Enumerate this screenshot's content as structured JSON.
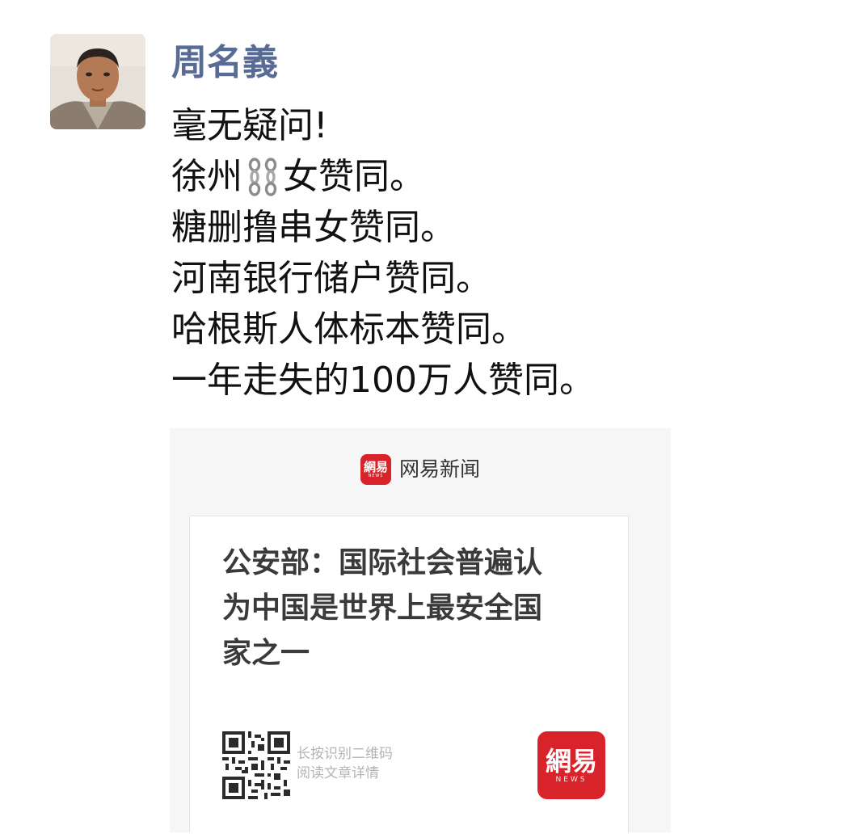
{
  "post": {
    "author": "周名義",
    "lines": [
      {
        "text": "毫无疑问!"
      },
      {
        "before": "徐州",
        "icon": "chain-icon",
        "after": "女赞同。"
      },
      {
        "text": "糖删撸串女赞同。"
      },
      {
        "text": "河南银行储户赞同。"
      },
      {
        "text": "哈根斯人体标本赞同。"
      },
      {
        "text": "一年走失的100万人赞同。"
      }
    ]
  },
  "shared_image": {
    "app_name": "网易新闻",
    "brand_small_glyph": "網易",
    "brand_small_sub": "NEWS",
    "headline_lines": [
      "公安部：国际社会普遍认",
      "为中国是世界上最安全国",
      "家之一"
    ],
    "qr_hint": [
      "长按识别二维码",
      "阅读文章详情"
    ],
    "brand_large_glyph": "網易",
    "brand_large_sub": "NEWS"
  },
  "colors": {
    "author_name": "#576b95",
    "body_text": "#111111",
    "brand_red": "#d8232a"
  },
  "icons": [
    "avatar-photo",
    "chain-icon",
    "netease-news-logo",
    "qr-code"
  ]
}
